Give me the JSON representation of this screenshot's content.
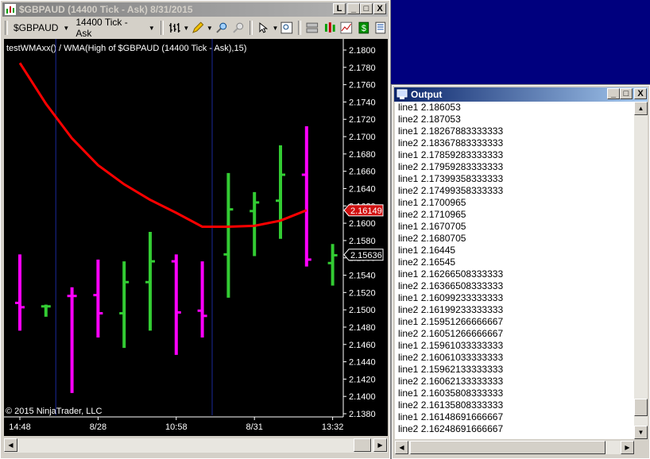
{
  "chart_window": {
    "title": "$GBPAUD (14400 Tick - Ask)  8/31/2015",
    "toolbar": {
      "instrument": "$GBPAUD",
      "period": "14400 Tick - Ask"
    },
    "indicator_label": "testWMAxx() / WMA(High of $GBPAUD (14400 Tick - Ask),15)",
    "copyright": "© 2015 NinjaTrader, LLC",
    "title_buttons": [
      "L",
      "_",
      "□",
      "X"
    ]
  },
  "chart_data": {
    "type": "bar",
    "y_ticks": [
      "2.1800",
      "2.1780",
      "2.1760",
      "2.1740",
      "2.1720",
      "2.1700",
      "2.1680",
      "2.1660",
      "2.1640",
      "2.1620",
      "2.1600",
      "2.1580",
      "2.1560",
      "2.1540",
      "2.1520",
      "2.1500",
      "2.1480",
      "2.1460",
      "2.1440",
      "2.1420",
      "2.1400",
      "2.1380"
    ],
    "ylim": [
      2.138,
      2.18
    ],
    "x_ticks": [
      "14:48",
      "8/28",
      "10:58",
      "8/31",
      "13:32"
    ],
    "last_price_label": "2.16149",
    "current_price_label": "2.15636",
    "bull_color": "#33cc33",
    "bear_color": "#ff00ff",
    "wma_color": "#ff0000",
    "bars": [
      {
        "open": 2.1508,
        "high": 2.1564,
        "low": 2.1476,
        "close": 2.1503,
        "dir": "down"
      },
      {
        "open": 2.1504,
        "high": 2.1506,
        "low": 2.1492,
        "close": 2.1504,
        "dir": "up"
      },
      {
        "open": 2.1516,
        "high": 2.1526,
        "low": 2.1404,
        "close": 2.1516,
        "dir": "down"
      },
      {
        "open": 2.1517,
        "high": 2.1558,
        "low": 2.1468,
        "close": 2.1496,
        "dir": "down"
      },
      {
        "open": 2.1496,
        "high": 2.1556,
        "low": 2.1456,
        "close": 2.1532,
        "dir": "up"
      },
      {
        "open": 2.1532,
        "high": 2.159,
        "low": 2.1476,
        "close": 2.1556,
        "dir": "up"
      },
      {
        "open": 2.1556,
        "high": 2.1564,
        "low": 2.1448,
        "close": 2.1497,
        "dir": "down"
      },
      {
        "open": 2.1499,
        "high": 2.1556,
        "low": 2.1468,
        "close": 2.1493,
        "dir": "down"
      },
      {
        "open": 2.1564,
        "high": 2.1658,
        "low": 2.1514,
        "close": 2.1616,
        "dir": "up"
      },
      {
        "open": 2.1614,
        "high": 2.1636,
        "low": 2.1562,
        "close": 2.1624,
        "dir": "up"
      },
      {
        "open": 2.1626,
        "high": 2.169,
        "low": 2.1582,
        "close": 2.1656,
        "dir": "up"
      },
      {
        "open": 2.1656,
        "high": 2.1712,
        "low": 2.155,
        "close": 2.1558,
        "dir": "down"
      },
      {
        "open": 2.1554,
        "high": 2.1576,
        "low": 2.1528,
        "close": 2.1563,
        "dir": "up"
      }
    ],
    "wma": [
      2.1785,
      2.1738,
      2.1698,
      2.1667,
      2.1645,
      2.1627,
      2.1612,
      2.1596,
      2.1596,
      2.1597,
      2.1603,
      2.1615
    ],
    "session_breaks": [
      1,
      7
    ]
  },
  "output_window": {
    "title": "Output",
    "title_buttons": [
      "_",
      "□",
      "X"
    ],
    "lines": [
      "line1 2.186053",
      "line2 2.187053",
      "line1 2.18267883333333",
      "line2 2.18367883333333",
      "line1 2.17859283333333",
      "line2 2.17959283333333",
      "line1 2.17399358333333",
      "line2 2.17499358333333",
      "line1 2.1700965",
      "line2 2.1710965",
      "line1 2.1670705",
      "line2 2.1680705",
      "line1 2.16445",
      "line2 2.16545",
      "line1 2.16266508333333",
      "line2 2.16366508333333",
      "line1 2.16099233333333",
      "line2 2.16199233333333",
      "line1 2.15951266666667",
      "line2 2.16051266666667",
      "line1 2.15961033333333",
      "line2 2.16061033333333",
      "line1 2.15962133333333",
      "line2 2.16062133333333",
      "line1 2.16035808333333",
      "line2 2.16135808333333",
      "line1 2.16148691666667",
      "line2 2.16248691666667"
    ]
  }
}
